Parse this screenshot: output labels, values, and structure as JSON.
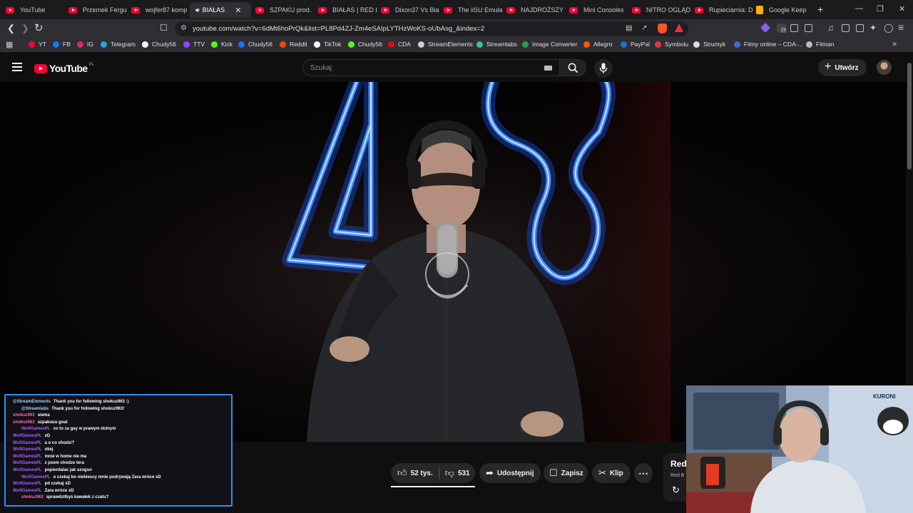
{
  "browser": {
    "tabs": [
      {
        "title": "YouTube",
        "icon": "youtube-icon"
      },
      {
        "title": "Przemek Fergu",
        "icon": "youtube-icon"
      },
      {
        "title": "wojfer87 komp",
        "icon": "youtube-icon"
      },
      {
        "title": "BIAŁAS",
        "icon": "speaker-icon",
        "active": true
      },
      {
        "title": "SZPAKU prod.",
        "icon": "youtube-icon"
      },
      {
        "title": "BIAŁAS | RED B",
        "icon": "youtube-icon"
      },
      {
        "title": "Dixon37 Vs Bia",
        "icon": "youtube-icon"
      },
      {
        "title": "The iiSU Emulat",
        "icon": "youtube-icon"
      },
      {
        "title": "NAJDROŻSZY",
        "icon": "youtube-icon"
      },
      {
        "title": "Mini Consoles",
        "icon": "youtube-icon"
      },
      {
        "title": "NITRO OGLĄD",
        "icon": "youtube-icon"
      },
      {
        "title": "Rupieciarnia: D",
        "icon": "youtube-icon"
      },
      {
        "title": "Google Keep",
        "icon": "google-keep-icon"
      }
    ],
    "new_tab": "+",
    "url": "youtube.com/watch?v=6dMt6hoPrQk&list=PL8Pd4ZJ-Zm4eSAIpLYTHzWoKS-oUbAsg_&index=2",
    "extension_badge": "77",
    "bookmarks": [
      {
        "label": "YT",
        "color": "#ff0033"
      },
      {
        "label": "FB",
        "color": "#1877f2"
      },
      {
        "label": "IG",
        "color": "#d62976"
      },
      {
        "label": "Telegram",
        "color": "#2aa1da"
      },
      {
        "label": "Chudy56",
        "color": "#ffffff"
      },
      {
        "label": "TTV",
        "color": "#9146ff"
      },
      {
        "label": "Kick",
        "color": "#53fc18"
      },
      {
        "label": "Chudy56",
        "color": "#1877f2"
      },
      {
        "label": "Reddit",
        "color": "#ff4500"
      },
      {
        "label": "TikTok",
        "color": "#ffffff"
      },
      {
        "label": "Chudy56",
        "color": "#53fc18"
      },
      {
        "label": "CDA",
        "color": "#e50914"
      },
      {
        "label": "StreamElements",
        "color": "#cccccc"
      },
      {
        "label": "Streamlabs",
        "color": "#31c3a2"
      },
      {
        "label": "Image Converter",
        "color": "#2e9e44"
      },
      {
        "label": "Allegro",
        "color": "#ff5a00"
      },
      {
        "label": "PayPal",
        "color": "#1f72c4"
      },
      {
        "label": "Symbolu",
        "color": "#e8334a"
      },
      {
        "label": "Strumyk",
        "color": "#dddddd"
      },
      {
        "label": "Filmy online – CDA-...",
        "color": "#3b6fd6"
      },
      {
        "label": "Filman",
        "color": "#bbbbbb"
      }
    ]
  },
  "youtube": {
    "logo_text": "YouTube",
    "country_code": "PL",
    "search_placeholder": "Szukaj",
    "create_label": "Utwórz",
    "actions": {
      "likes": "52 tys.",
      "dislikes": "531",
      "share": "Udostępnij",
      "save": "Zapisz",
      "clip": "Klip"
    },
    "channel_peek": {
      "title": "Red",
      "subtitle": "Red B"
    },
    "video_overlay_text": "48"
  },
  "chat": [
    {
      "user": "@StreamElements",
      "user_color": "#a0d8ff",
      "text": "Thank you for following shokuz963 :)"
    },
    {
      "user": "@Streamlabs",
      "user_color": "#a0d8ff",
      "text": "Thank you for following shokuz963!",
      "indent": true
    },
    {
      "user": "shokuz963",
      "user_color": "#ff6aa8",
      "text": "siema"
    },
    {
      "user": "shokuz963",
      "user_color": "#ff6aa8",
      "text": "szpakuuu goat"
    },
    {
      "user": "WofiGamesPL",
      "user_color": "#b25cff",
      "text": "co to za gay w prawym dolnym",
      "indent": true
    },
    {
      "user": "WofiGamesPL",
      "user_color": "#b25cff",
      "text": "xD"
    },
    {
      "user": "WofiGamesPL",
      "user_color": "#b25cff",
      "text": "a o co chodzi?"
    },
    {
      "user": "WofiGamesPL",
      "user_color": "#b25cff",
      "text": "okej"
    },
    {
      "user": "WofiGamesPL",
      "user_color": "#b25cff",
      "text": "mnie w home nie ma"
    },
    {
      "user": "WofiGamesPL",
      "user_color": "#b25cff",
      "text": "z psem chodze tera"
    },
    {
      "user": "WofiGamesPL",
      "user_color": "#b25cff",
      "text": "popierdalac jak szogun"
    },
    {
      "user": "WofiGamesPL",
      "user_color": "#b25cff",
      "text": "o czekaj bo niebiescy mnie podrywają Zara wróce xD",
      "indent": true
    },
    {
      "user": "WofiGamesPL",
      "user_color": "#b25cff",
      "text": "pd czekaj xD"
    },
    {
      "user": "WofiGamesPL",
      "user_color": "#b25cff",
      "text": "Zara wróce xD"
    },
    {
      "user": "shokuz963",
      "user_color": "#ff6aa8",
      "text": "sprawdzilbyś kawałek z czatu?",
      "indent": true
    }
  ],
  "webcam": {
    "logo_text": "KURONI"
  }
}
